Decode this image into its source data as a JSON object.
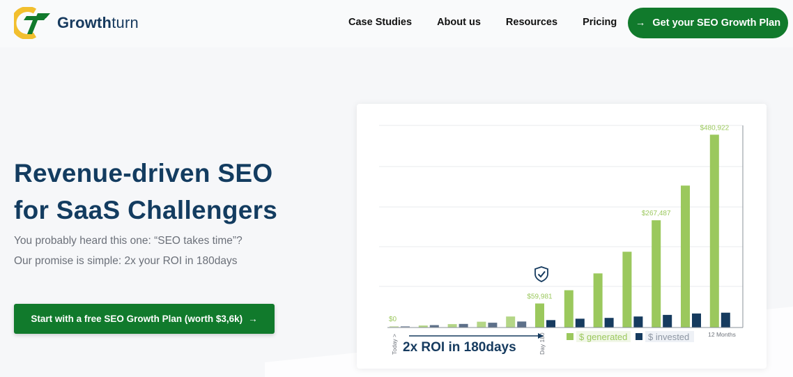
{
  "header": {
    "brand": {
      "bold": "Growth",
      "light": "turn"
    },
    "nav": [
      "Case Studies",
      "About us",
      "Resources",
      "Pricing"
    ],
    "cta": "Get your SEO Growth Plan"
  },
  "hero": {
    "title_line1": "Revenue-driven SEO",
    "title_line2": "for SaaS Challengers",
    "sub_line1": "You probably heard this one: “SEO takes time”?",
    "sub_line2": "Our promise is simple: 2x your ROI in 180days",
    "cta": "Start with a free SEO Growth Plan (worth $3,6k)"
  },
  "chart_data": {
    "type": "bar",
    "title": "",
    "categories": [
      "Today",
      "",
      "",
      "",
      "",
      "Day 180",
      "",
      "",
      "",
      "",
      "",
      "12 Months"
    ],
    "x_labels": {
      "start": "Today >",
      "middle": "Day 180",
      "end": "12 Months"
    },
    "series": [
      {
        "name": "$ generated",
        "color": "#9bc85d",
        "values": [
          0,
          5000,
          8500,
          14500,
          27500,
          59981,
          93000,
          135000,
          189000,
          267487,
          354000,
          480922
        ]
      },
      {
        "name": "$ invested",
        "color": "#163b5f",
        "values": [
          3500,
          6000,
          9000,
          12000,
          15000,
          18500,
          22000,
          24000,
          27500,
          31500,
          35000,
          37000
        ]
      }
    ],
    "data_labels": [
      {
        "index": 0,
        "text": "$0"
      },
      {
        "index": 5,
        "text": "$59,981"
      },
      {
        "index": 9,
        "text": "$267,487"
      },
      {
        "index": 11,
        "text": "$480,922"
      }
    ],
    "annotation": "2x ROI in 180days",
    "ylim": [
      0,
      504000
    ],
    "grid": true,
    "legend": "bottom-center"
  },
  "colors": {
    "brand_green": "#117a2c",
    "navy": "#133c60",
    "bar_green": "#9bc85d",
    "bar_navy": "#163b5f"
  }
}
